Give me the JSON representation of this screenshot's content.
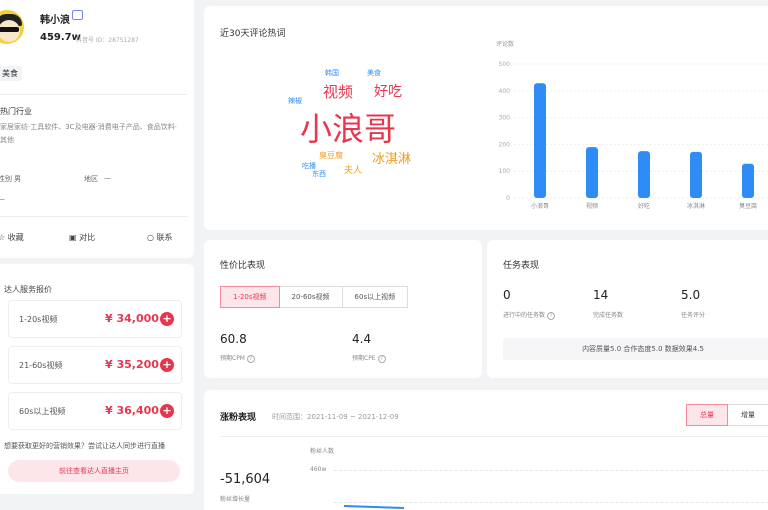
{
  "profile": {
    "nickname": "韩小浪",
    "fans": "459.7w",
    "uid": "抖音号 ID：28751287",
    "category_tag": "美食",
    "industry_title": "热门行业",
    "industry_desc": "家居家纺·工具软件、3C及电器·消费电子产品、食品饮料·其他",
    "gender_label": "性别",
    "gender_value": "男",
    "region_label": "地区",
    "region_value": "—",
    "age_value": "—",
    "collect_label": "收藏",
    "compare_label": "对比",
    "contact_label": "联系"
  },
  "services": {
    "title": "达人服务报价",
    "items": [
      {
        "name": "1-20s视频",
        "price": "¥ 34,000"
      },
      {
        "name": "21-60s视频",
        "price": "¥ 35,200"
      },
      {
        "name": "60s以上视频",
        "price": "¥ 36,400"
      }
    ],
    "hint": "想要获取更好的营销效果？尝试让达人同步进行直播",
    "live_button": "前往查看达人直播主页"
  },
  "wordcloud": {
    "title": "近30天评论热词",
    "words": [
      "小浪哥",
      "视频",
      "好吃",
      "冰淇淋",
      "美食",
      "韩国",
      "夫人",
      "东西",
      "辣椒",
      "臭豆腐",
      "吃播"
    ]
  },
  "chart_data": {
    "type": "bar",
    "title": "",
    "ylabel": "评论数",
    "categories": [
      "小浪哥",
      "视频",
      "好吃",
      "冰淇淋",
      "臭豆腐"
    ],
    "values": [
      428,
      190,
      175,
      172,
      128
    ],
    "ylim": [
      0,
      500
    ],
    "yticks": [
      "0",
      "100",
      "200",
      "300",
      "400",
      "500"
    ],
    "bar_color": "#2f8cf7"
  },
  "price_perf": {
    "title": "性价比表现",
    "tabs": [
      "1-20s视频",
      "20-60s视频",
      "60s以上视频"
    ],
    "cpm_value": "60.8",
    "cpm_label": "预期CPM",
    "cpe_value": "4.4",
    "cpe_label": "预期CPE"
  },
  "task": {
    "title": "任务表现",
    "stats": [
      {
        "value": "0",
        "label": "进行中的任务数"
      },
      {
        "value": "14",
        "label": "完成任务数"
      },
      {
        "value": "5.0",
        "label": "任务评分"
      }
    ],
    "score_line": "内容质量5.0  合作态度5.0  数据效果4.5"
  },
  "fans_perf": {
    "title": "涨粉表现",
    "range": "时间范围：2021-11-09 ~ 2021-12-09",
    "toggle": [
      "总量",
      "增量"
    ],
    "value": "-51,604",
    "value_label": "粉丝增长量",
    "chart_ylabel": "粉丝人数",
    "tick_top": "460w"
  }
}
